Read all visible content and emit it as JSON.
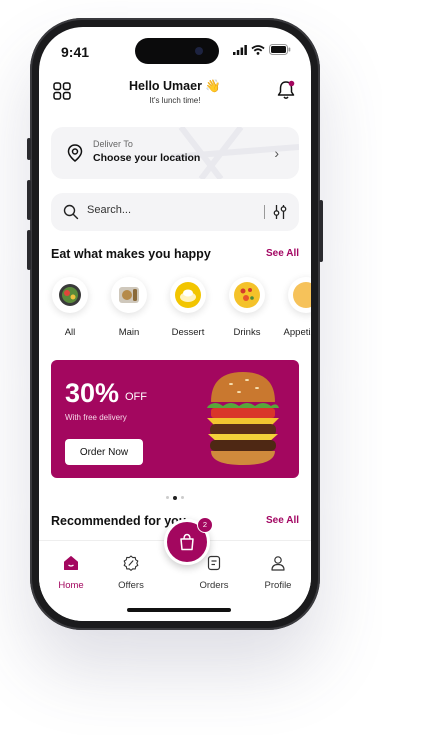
{
  "status_bar": {
    "time": "9:41"
  },
  "header": {
    "greeting": "Hello Umaer 👋",
    "subtitle": "It's lunch time!"
  },
  "location": {
    "label": "Deliver To",
    "value": "Choose your location"
  },
  "search": {
    "placeholder": "Search..."
  },
  "categories_section": {
    "title": "Eat what makes you happy",
    "see_all": "See All",
    "items": [
      {
        "label": "All"
      },
      {
        "label": "Main"
      },
      {
        "label": "Dessert"
      },
      {
        "label": "Drinks"
      },
      {
        "label": "Appetizers"
      }
    ]
  },
  "promo": {
    "percent": "30%",
    "off": "OFF",
    "subtitle": "With free delivery",
    "cta": "Order Now"
  },
  "recommended": {
    "title": "Recommended for you",
    "see_all": "See All"
  },
  "cart": {
    "count": "2"
  },
  "tabs": [
    {
      "label": "Home"
    },
    {
      "label": "Offers"
    },
    {
      "label": "Orders"
    },
    {
      "label": "Profile"
    }
  ],
  "colors": {
    "accent": "#a3075f"
  }
}
